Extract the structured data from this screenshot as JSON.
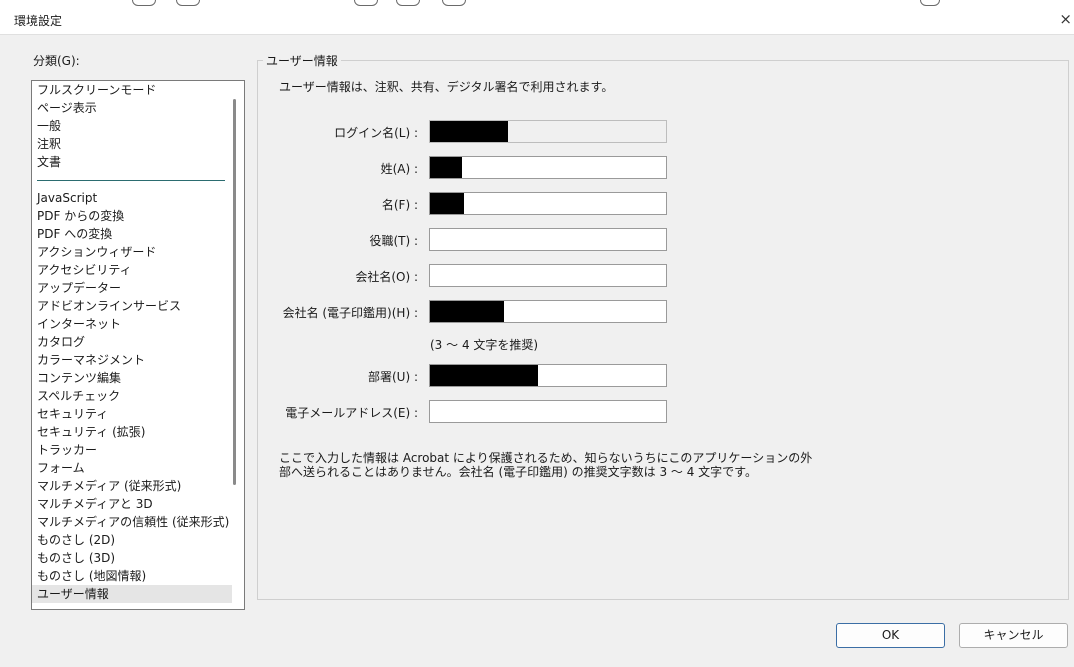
{
  "window": {
    "title": "環境設定",
    "close_glyph": "×"
  },
  "categories": {
    "label": "分類(G):",
    "top_items": [
      "フルスクリーンモード",
      "ページ表示",
      "一般",
      "注釈",
      "文書"
    ],
    "items": [
      "JavaScript",
      "PDF からの変換",
      "PDF への変換",
      "アクションウィザード",
      "アクセシビリティ",
      "アップデーター",
      "アドビオンラインサービス",
      "インターネット",
      "カタログ",
      "カラーマネジメント",
      "コンテンツ編集",
      "スペルチェック",
      "セキュリティ",
      "セキュリティ (拡張)",
      "トラッカー",
      "フォーム",
      "マルチメディア (従来形式)",
      "マルチメディアと 3D",
      "マルチメディアの信頼性 (従来形式)",
      "ものさし (2D)",
      "ものさし (3D)",
      "ものさし (地図情報)",
      "ユーザー情報"
    ],
    "selected": "ユーザー情報"
  },
  "panel": {
    "title": "ユーザー情報",
    "description": "ユーザー情報は、注釈、共有、デジタル署名で利用されます。",
    "fields": {
      "login": {
        "label": "ログイン名(L) :",
        "value": ""
      },
      "last_name": {
        "label": "姓(A) :",
        "value": ""
      },
      "first_name": {
        "label": "名(F) :",
        "value": ""
      },
      "title": {
        "label": "役職(T) :",
        "value": ""
      },
      "company": {
        "label": "会社名(O) :",
        "value": ""
      },
      "company_seal": {
        "label": "会社名 (電子印鑑用)(H) :",
        "value": "",
        "hint": "(3 ～ 4 文字を推奨)"
      },
      "department": {
        "label": "部署(U) :",
        "value": ""
      },
      "email": {
        "label": "電子メールアドレス(E) :",
        "value": ""
      }
    },
    "note": "ここで入力した情報は Acrobat により保護されるため、知らないうちにこのアプリケーションの外部へ送られることはありません。会社名 (電子印鑑用) の推奨文字数は 3 ～ 4 文字です。"
  },
  "buttons": {
    "ok": "OK",
    "cancel": "キャンセル"
  }
}
